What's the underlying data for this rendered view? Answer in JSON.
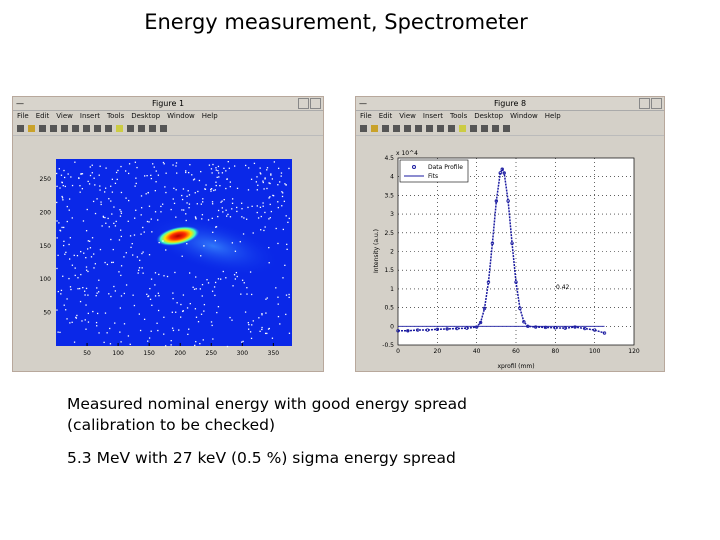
{
  "slide": {
    "title": "Energy measurement, Spectrometer",
    "lines": [
      "Measured nominal energy with good energy spread",
      "(calibration to be checked)",
      "5.3 MeV with 27 keV (0.5 %) sigma energy spread"
    ]
  },
  "menu": [
    "File",
    "Edit",
    "View",
    "Insert",
    "Tools",
    "Desktop",
    "Window",
    "Help"
  ],
  "fig1": {
    "title": "Figure 1",
    "xticks": [
      50,
      100,
      150,
      200,
      250,
      300,
      350
    ],
    "yticks": [
      50,
      100,
      150,
      200,
      250
    ],
    "xlim": [
      0,
      380
    ],
    "ylim": [
      0,
      280
    ],
    "colormap": "jet",
    "background": "#0a28e8"
  },
  "fig8": {
    "title": "Figure 8"
  },
  "chart_data": [
    {
      "type": "heatmap",
      "xticks": [
        50,
        100,
        150,
        200,
        250,
        300,
        350
      ],
      "yticks": [
        50,
        100,
        150,
        200,
        250
      ],
      "peak": {
        "x": 200,
        "y": 165
      }
    },
    {
      "type": "scatter",
      "xlabel": "xprofil (mm)",
      "ylabel": "Intensity (a.u.)",
      "multiplier": "x 10^4",
      "xlim": [
        0,
        120
      ],
      "ylim": [
        -0.5,
        4.5
      ],
      "xticks": [
        0,
        20,
        40,
        60,
        80,
        100,
        120
      ],
      "yticks": [
        -0.5,
        0,
        0.5,
        1,
        1.5,
        2,
        2.5,
        3,
        3.5,
        4,
        4.5
      ],
      "grid": true,
      "legend": "top-left",
      "annotation": "0.42",
      "series": [
        {
          "name": "Data Profile",
          "color": "#1a1aa0",
          "x": [
            0,
            5,
            10,
            15,
            20,
            25,
            30,
            35,
            40,
            42,
            44,
            46,
            48,
            50,
            52,
            53,
            54,
            56,
            58,
            60,
            62,
            64,
            66,
            70,
            75,
            80,
            85,
            90,
            95,
            100,
            105
          ],
          "y": [
            -0.12,
            -0.12,
            -0.1,
            -0.1,
            -0.08,
            -0.07,
            -0.06,
            -0.05,
            -0.02,
            0.1,
            0.48,
            1.18,
            2.22,
            3.35,
            4.1,
            4.2,
            4.1,
            3.35,
            2.22,
            1.18,
            0.48,
            0.12,
            0.0,
            -0.02,
            -0.03,
            -0.04,
            -0.05,
            -0.02,
            -0.06,
            -0.1,
            -0.18
          ]
        },
        {
          "name": "Fits",
          "color": "#1a1aa0",
          "x": [
            0,
            105
          ],
          "y": [
            0,
            0
          ]
        }
      ]
    }
  ]
}
